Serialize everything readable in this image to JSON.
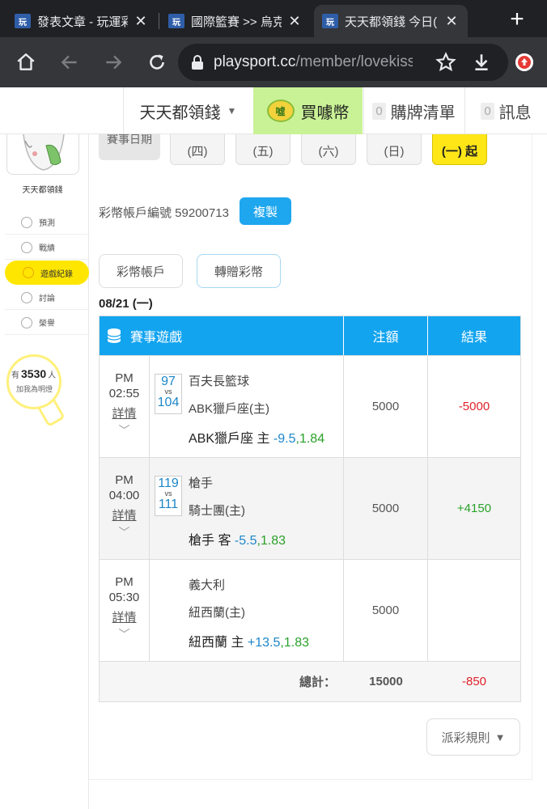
{
  "browser": {
    "tabs": [
      {
        "title": "發表文章 - 玩運彩",
        "favicon": "玩"
      },
      {
        "title": "國際籃賽 >> 烏克",
        "favicon": "玩"
      },
      {
        "title": "天天都領錢 今日(",
        "favicon": "玩"
      }
    ],
    "url_host": "playsport.cc",
    "url_path": "/member/lovekiss"
  },
  "header": {
    "user_name": "天天都領錢",
    "coin_badge": "噓",
    "buy_label": "買噱幣",
    "buylist_count": "0",
    "buylist_label": "購牌清單",
    "msg_count": "0",
    "msg_label": "訊息"
  },
  "sidebar": {
    "name": "天天都領錢",
    "items": [
      {
        "label": "預測",
        "icon": "target-icon"
      },
      {
        "label": "戰績",
        "icon": "chart-icon"
      },
      {
        "label": "遊戲紀錄",
        "icon": "record-icon"
      },
      {
        "label": "討論",
        "icon": "discuss-icon"
      },
      {
        "label": "榮譽",
        "icon": "medal-icon"
      }
    ],
    "fans_prefix": "有",
    "fans_count": "3530",
    "fans_suffix": "人",
    "fans_sub": "加我為明燈"
  },
  "date_nav": {
    "label": "賽事日期",
    "days": [
      {
        "weekday": "(四)",
        "active": false
      },
      {
        "weekday": "(五)",
        "active": false
      },
      {
        "weekday": "(六)",
        "active": false
      },
      {
        "weekday": "(日)",
        "active": false
      },
      {
        "weekday": "(一) 起",
        "active": true
      }
    ]
  },
  "account": {
    "label": "彩幣帳戶編號 59200713",
    "copy_label": "複製"
  },
  "tabs": {
    "wallet": "彩幣帳戶",
    "transfer": "轉贈彩幣"
  },
  "day_title": "08/21 (一)",
  "table": {
    "headers": {
      "game": "賽事遊戲",
      "amount": "注額",
      "result": "結果"
    },
    "rows": [
      {
        "ampm": "PM",
        "time": "02:55",
        "detail": "詳情",
        "score_a": "97",
        "vs": "vs",
        "score_b": "104",
        "team1": "百夫長籃球",
        "team2": "ABK獵戶座(主)",
        "pick_team": "ABK獵戶座 主",
        "spread": "-9.5",
        "odds": "1.84",
        "amount": "5000",
        "result": "-5000",
        "result_type": "neg"
      },
      {
        "ampm": "PM",
        "time": "04:00",
        "detail": "詳情",
        "score_a": "119",
        "vs": "vs",
        "score_b": "111",
        "team1": "槍手",
        "team2": "騎士團(主)",
        "pick_team": "槍手 客",
        "spread": "-5.5",
        "odds": "1.83",
        "amount": "5000",
        "result": "+4150",
        "result_type": "pos"
      },
      {
        "ampm": "PM",
        "time": "05:30",
        "detail": "詳情",
        "score_a": "",
        "vs": "",
        "score_b": "",
        "team1": "義大利",
        "team2": "紐西蘭(主)",
        "pick_team": "紐西蘭 主",
        "spread": "+13.5",
        "odds": "1.83",
        "amount": "5000",
        "result": "",
        "result_type": ""
      }
    ],
    "total_label": "總計：",
    "total_amount": "15000",
    "total_result": "-850"
  },
  "rules_label": "派彩規則"
}
